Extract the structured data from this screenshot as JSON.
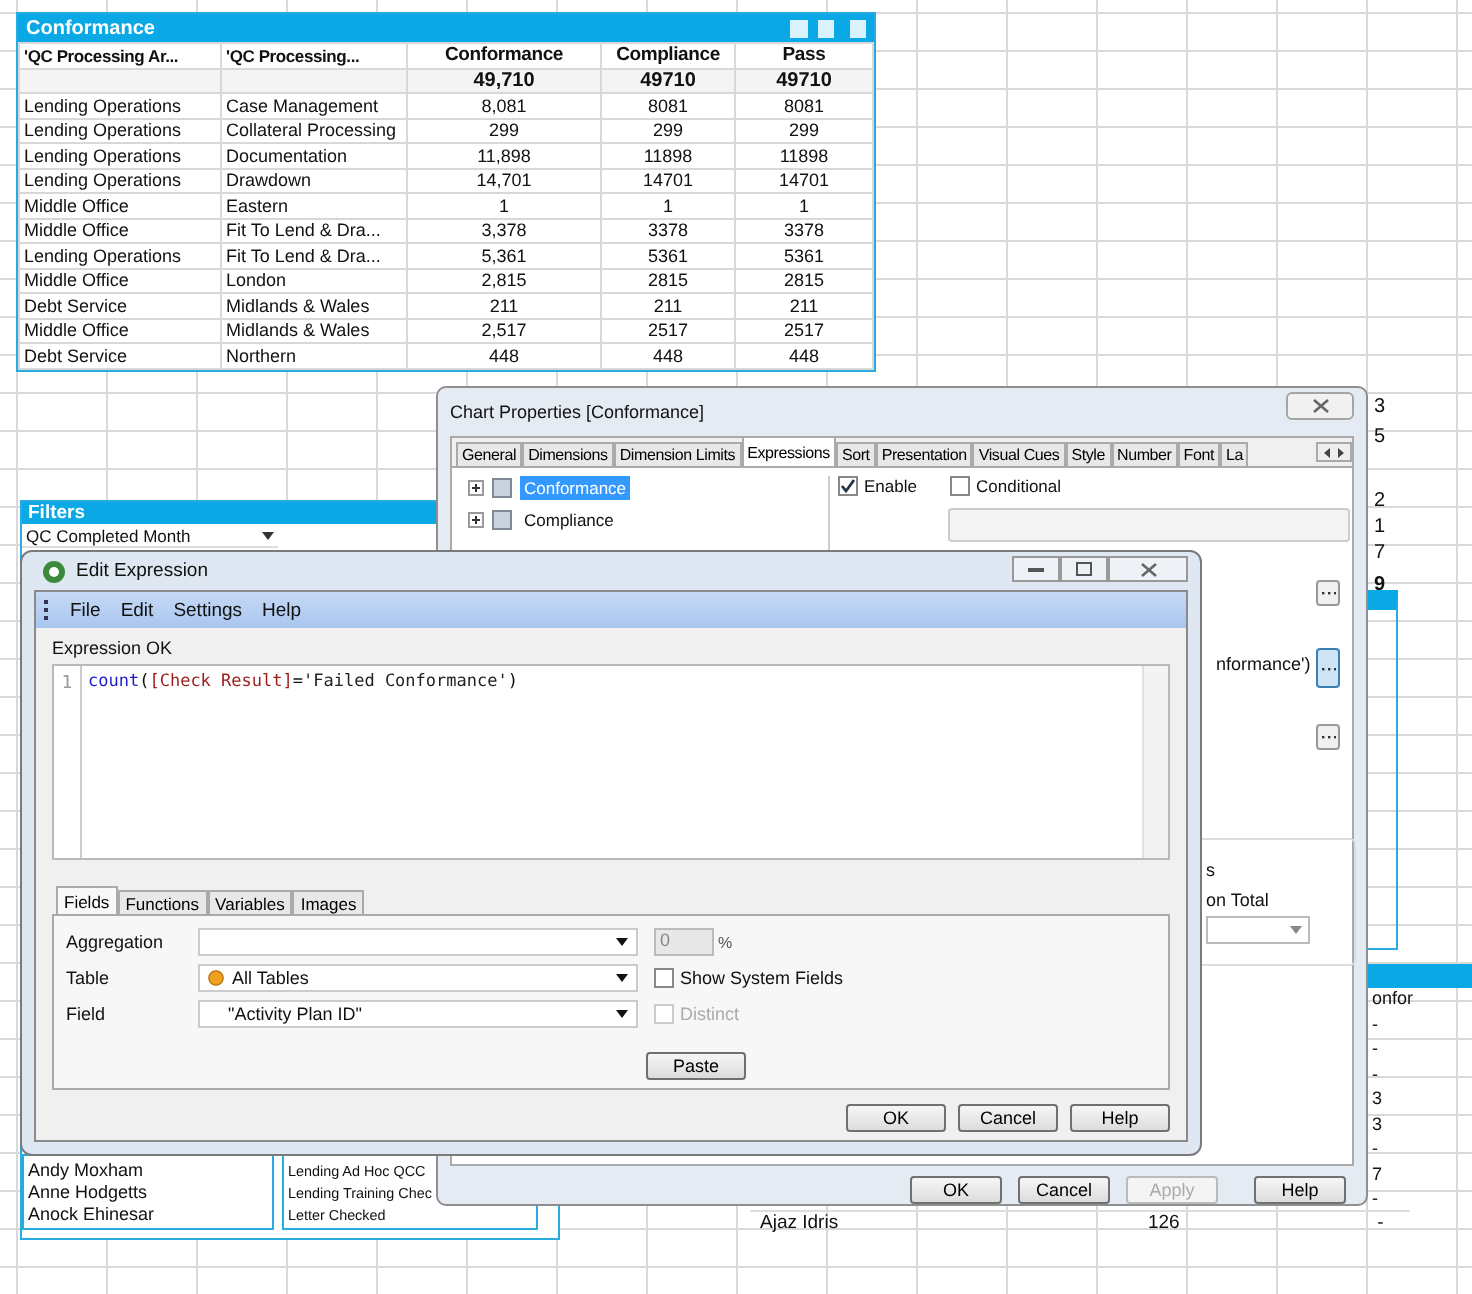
{
  "conformance_table": {
    "title": "Conformance",
    "columns": [
      "'QC Processing Ar...",
      "'QC Processing...",
      "Conformance",
      "Compliance",
      "Pass"
    ],
    "totals": [
      "49,710",
      "49710",
      "49710"
    ],
    "rows": [
      [
        "Lending Operations",
        "Case Management",
        "8,081",
        "8081",
        "8081"
      ],
      [
        "Lending Operations",
        "Collateral Processing",
        "299",
        "299",
        "299"
      ],
      [
        "Lending Operations",
        "Documentation",
        "11,898",
        "11898",
        "11898"
      ],
      [
        "Lending Operations",
        "Drawdown",
        "14,701",
        "14701",
        "14701"
      ],
      [
        "Middle Office",
        "Eastern",
        "1",
        "1",
        "1"
      ],
      [
        "Middle Office",
        "Fit To Lend & Dra...",
        "3,378",
        "3378",
        "3378"
      ],
      [
        "Lending Operations",
        "Fit To Lend & Dra...",
        "5,361",
        "5361",
        "5361"
      ],
      [
        "Middle Office",
        "London",
        "2,815",
        "2815",
        "2815"
      ],
      [
        "Debt Service",
        "Midlands & Wales",
        "211",
        "211",
        "211"
      ],
      [
        "Middle Office",
        "Midlands & Wales",
        "2,517",
        "2517",
        "2517"
      ],
      [
        "Debt Service",
        "Northern",
        "448",
        "448",
        "448"
      ]
    ]
  },
  "filters": {
    "title": "Filters",
    "dropdown": "QC Completed Month",
    "list_1": [
      "Andy Moxham",
      "Anne Hodgetts",
      "Anock Ehinesar"
    ],
    "list_2": [
      "Lending Ad Hoc QCC",
      "Lending Training Chec",
      "Letter Checked"
    ]
  },
  "background_table": {
    "top_values": [
      "3",
      "5",
      "2",
      "1",
      "7",
      "9"
    ],
    "column_header": "onfor",
    "values": [
      "-",
      "-",
      "-",
      "3",
      "3",
      "-",
      "7",
      "-"
    ],
    "row": {
      "name": "Ajaz Idris",
      "value": "126",
      "mark": "-"
    }
  },
  "chart_properties": {
    "title": "Chart Properties [Conformance]",
    "tabs": [
      {
        "label": "General",
        "selected": false
      },
      {
        "label": "Dimensions",
        "selected": false
      },
      {
        "label": "Dimension Limits",
        "selected": false
      },
      {
        "label": "Expressions",
        "selected": true
      },
      {
        "label": "Sort",
        "selected": false
      },
      {
        "label": "Presentation",
        "selected": false
      },
      {
        "label": "Visual Cues",
        "selected": false
      },
      {
        "label": "Style",
        "selected": false
      },
      {
        "label": "Number",
        "selected": false
      },
      {
        "label": "Font",
        "selected": false
      },
      {
        "label": "La",
        "selected": false
      }
    ],
    "expressions": [
      {
        "label": "Conformance",
        "selected": true
      },
      {
        "label": "Compliance",
        "selected": false
      }
    ],
    "enable": {
      "label": "Enable",
      "checked": true
    },
    "conditional": {
      "label": "Conditional",
      "checked": false
    },
    "definition_fragment": "nformance')",
    "group_fragments": [
      "s",
      "on Total"
    ],
    "buttons": [
      {
        "label": "OK",
        "disabled": false
      },
      {
        "label": "Cancel",
        "disabled": false
      },
      {
        "label": "Apply",
        "disabled": true
      },
      {
        "label": "Help",
        "disabled": false
      }
    ]
  },
  "edit_expression": {
    "title": "Edit Expression",
    "menu": [
      "File",
      "Edit",
      "Settings",
      "Help"
    ],
    "status": "Expression OK",
    "line_number": "1",
    "code": [
      {
        "kind": "function",
        "text": "count"
      },
      {
        "kind": "operator",
        "text": "("
      },
      {
        "kind": "field",
        "text": "[Check Result]"
      },
      {
        "kind": "operator",
        "text": "="
      },
      {
        "kind": "string",
        "text": "'Failed Conformance'"
      },
      {
        "kind": "operator",
        "text": ")"
      }
    ],
    "tabs": [
      {
        "label": "Fields",
        "selected": true
      },
      {
        "label": "Functions",
        "selected": false
      },
      {
        "label": "Variables",
        "selected": false
      },
      {
        "label": "Images",
        "selected": false
      }
    ],
    "aggregation_label": "Aggregation",
    "percent_value": "0",
    "percent_unit": "%",
    "table_label": "Table",
    "table_value": "All Tables",
    "field_label": "Field",
    "field_value": "\"Activity Plan ID\"",
    "show_system_fields": {
      "label": "Show System Fields",
      "checked": false,
      "disabled": false
    },
    "distinct": {
      "label": "Distinct",
      "checked": false,
      "disabled": true
    },
    "paste": "Paste",
    "buttons": [
      "OK",
      "Cancel",
      "Help"
    ]
  }
}
